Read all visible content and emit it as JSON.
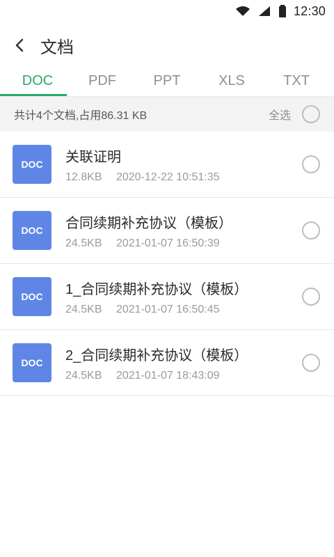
{
  "status_bar": {
    "time": "12:30",
    "icons": [
      "wifi-icon",
      "signal-icon",
      "battery-icon"
    ]
  },
  "header": {
    "title": "文档"
  },
  "tabs": [
    {
      "label": "DOC",
      "active": true
    },
    {
      "label": "PDF",
      "active": false
    },
    {
      "label": "PPT",
      "active": false
    },
    {
      "label": "XLS",
      "active": false
    },
    {
      "label": "TXT",
      "active": false
    }
  ],
  "summary": {
    "count_text": "共计4个文档,占用86.31 KB",
    "select_all_label": "全选"
  },
  "files": [
    {
      "type": "DOC",
      "name": "关联证明",
      "size": "12.8KB",
      "datetime": "2020-12-22 10:51:35"
    },
    {
      "type": "DOC",
      "name": "合同续期补充协议（模板）",
      "size": "24.5KB",
      "datetime": "2021-01-07 16:50:39"
    },
    {
      "type": "DOC",
      "name": "1_合同续期补充协议（模板）",
      "size": "24.5KB",
      "datetime": "2021-01-07 16:50:45"
    },
    {
      "type": "DOC",
      "name": "2_合同续期补充协议（模板）",
      "size": "24.5KB",
      "datetime": "2021-01-07 18:43:09"
    }
  ],
  "colors": {
    "accent_green": "#2aa866",
    "doc_blue": "#5f86e6"
  }
}
